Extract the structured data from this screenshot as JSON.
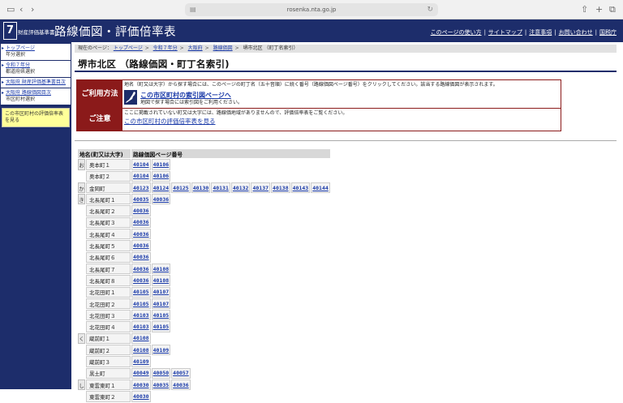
{
  "browser": {
    "url": "rosenka.nta.go.jp"
  },
  "header": {
    "logo_num": "7",
    "logo_sub": "財産評価基準書",
    "title": "路線価図・評価倍率表",
    "nav": [
      "このページの使い方",
      "サイトマップ",
      "注意事項",
      "お問い合わせ",
      "国税庁"
    ]
  },
  "sidebar": {
    "items": [
      {
        "link": "トップページ",
        "sub": "年分選択"
      },
      {
        "link": "令和７年分",
        "sub": "都道府県選択"
      },
      {
        "link": "大阪府 財産評価基準書目次",
        "sub": ""
      },
      {
        "link": "大阪府 路線価図目次",
        "sub": "市区町村選択"
      }
    ],
    "note": "この市区町村の評価倍率表を見る"
  },
  "breadcrumb": {
    "prefix": "現在のページ：",
    "links": [
      "トップページ",
      "令和７年分",
      "大阪府",
      "路線価図"
    ],
    "current": "堺市北区 （町丁名索引）"
  },
  "page_title": "堺市北区 （路線価図・町丁名索引)",
  "info": {
    "usage_label": "ご利用方法",
    "usage_text": "地名（町又は大字）から探す場合には、このページの町丁名（五十音順）に続く番号（路線価図ページ番号）をクリックしてください。該当する路線価図が表示されます。",
    "usage_link": "この市区町村の索引図ページへ",
    "usage_sub": "地図で探す場合には索引図をご利用ください。",
    "caution_label": "ご注意",
    "caution_text": "ここに掲載されていない町又は大字には、路線価地域がありませんので、評価倍率表をご覧ください。",
    "caution_link": "この市区町村の評価倍率表を見る"
  },
  "table": {
    "headers": [
      "地名(町又は大字)",
      "路線価図ページ番号"
    ],
    "rows": [
      {
        "kana": "お",
        "name": "奥本町１",
        "pages": [
          "40104",
          "40106"
        ]
      },
      {
        "kana": "",
        "name": "奥本町２",
        "pages": [
          "40104",
          "40106"
        ]
      },
      {
        "kana": "か",
        "name": "金岡町",
        "pages": [
          "40123",
          "40124",
          "40125",
          "40130",
          "40131",
          "40132",
          "40137",
          "40138",
          "40143",
          "40144"
        ]
      },
      {
        "kana": "き",
        "name": "北長尾町１",
        "pages": [
          "40035",
          "40036"
        ]
      },
      {
        "kana": "",
        "name": "北長尾町２",
        "pages": [
          "40036"
        ]
      },
      {
        "kana": "",
        "name": "北長尾町３",
        "pages": [
          "40036"
        ]
      },
      {
        "kana": "",
        "name": "北長尾町４",
        "pages": [
          "40036"
        ]
      },
      {
        "kana": "",
        "name": "北長尾町５",
        "pages": [
          "40036"
        ]
      },
      {
        "kana": "",
        "name": "北長尾町６",
        "pages": [
          "40036"
        ]
      },
      {
        "kana": "",
        "name": "北長尾町７",
        "pages": [
          "40036",
          "40108"
        ]
      },
      {
        "kana": "",
        "name": "北長尾町８",
        "pages": [
          "40036",
          "40108"
        ]
      },
      {
        "kana": "",
        "name": "北花田町１",
        "pages": [
          "40105",
          "40107"
        ]
      },
      {
        "kana": "",
        "name": "北花田町２",
        "pages": [
          "40105",
          "40107"
        ]
      },
      {
        "kana": "",
        "name": "北花田町３",
        "pages": [
          "40103",
          "40105"
        ]
      },
      {
        "kana": "",
        "name": "北花田町４",
        "pages": [
          "40103",
          "40105"
        ]
      },
      {
        "kana": "く",
        "name": "蔵前町１",
        "pages": [
          "40108"
        ]
      },
      {
        "kana": "",
        "name": "蔵前町２",
        "pages": [
          "40108",
          "40109"
        ]
      },
      {
        "kana": "",
        "name": "蔵前町３",
        "pages": [
          "40109"
        ]
      },
      {
        "kana": "",
        "name": "黒土町",
        "pages": [
          "40049",
          "40050",
          "40057"
        ]
      },
      {
        "kana": "し",
        "name": "東雲東町１",
        "pages": [
          "40030",
          "40035",
          "40036"
        ]
      },
      {
        "kana": "",
        "name": "東雲東町２",
        "pages": [
          "40030"
        ]
      }
    ]
  }
}
